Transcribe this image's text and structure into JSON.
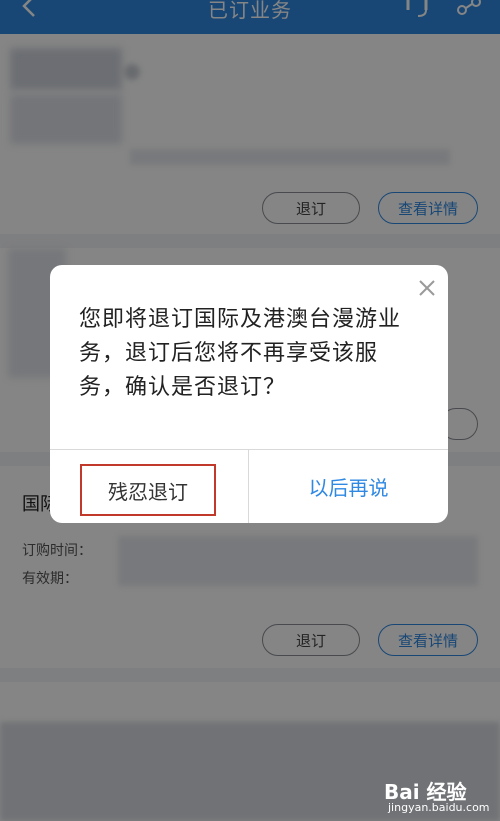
{
  "header": {
    "title": "已订业务",
    "back_icon": "chevron-left-icon",
    "headset_icon": "headset-icon",
    "share_icon": "share-icon"
  },
  "cards": [
    {
      "unsubscribe_label": "退订",
      "details_label": "查看详情"
    },
    {
      "title_fragment": "国际",
      "order_time_label": "订购时间：",
      "validity_label": "有效期：",
      "unsubscribe_label": "退订",
      "details_label": "查看详情"
    }
  ],
  "dialog": {
    "message": "您即将退订国际及港澳台漫游业务，退订后您将不再享受该服务，确认是否退订？",
    "confirm_label": "残忍退订",
    "cancel_label": "以后再说",
    "close_icon": "close-icon"
  },
  "watermark": {
    "text": "Bai 经验",
    "url": "jingyan.baidu.com"
  },
  "colors": {
    "accent": "#2f89e3",
    "highlight_border": "#c0392b"
  }
}
